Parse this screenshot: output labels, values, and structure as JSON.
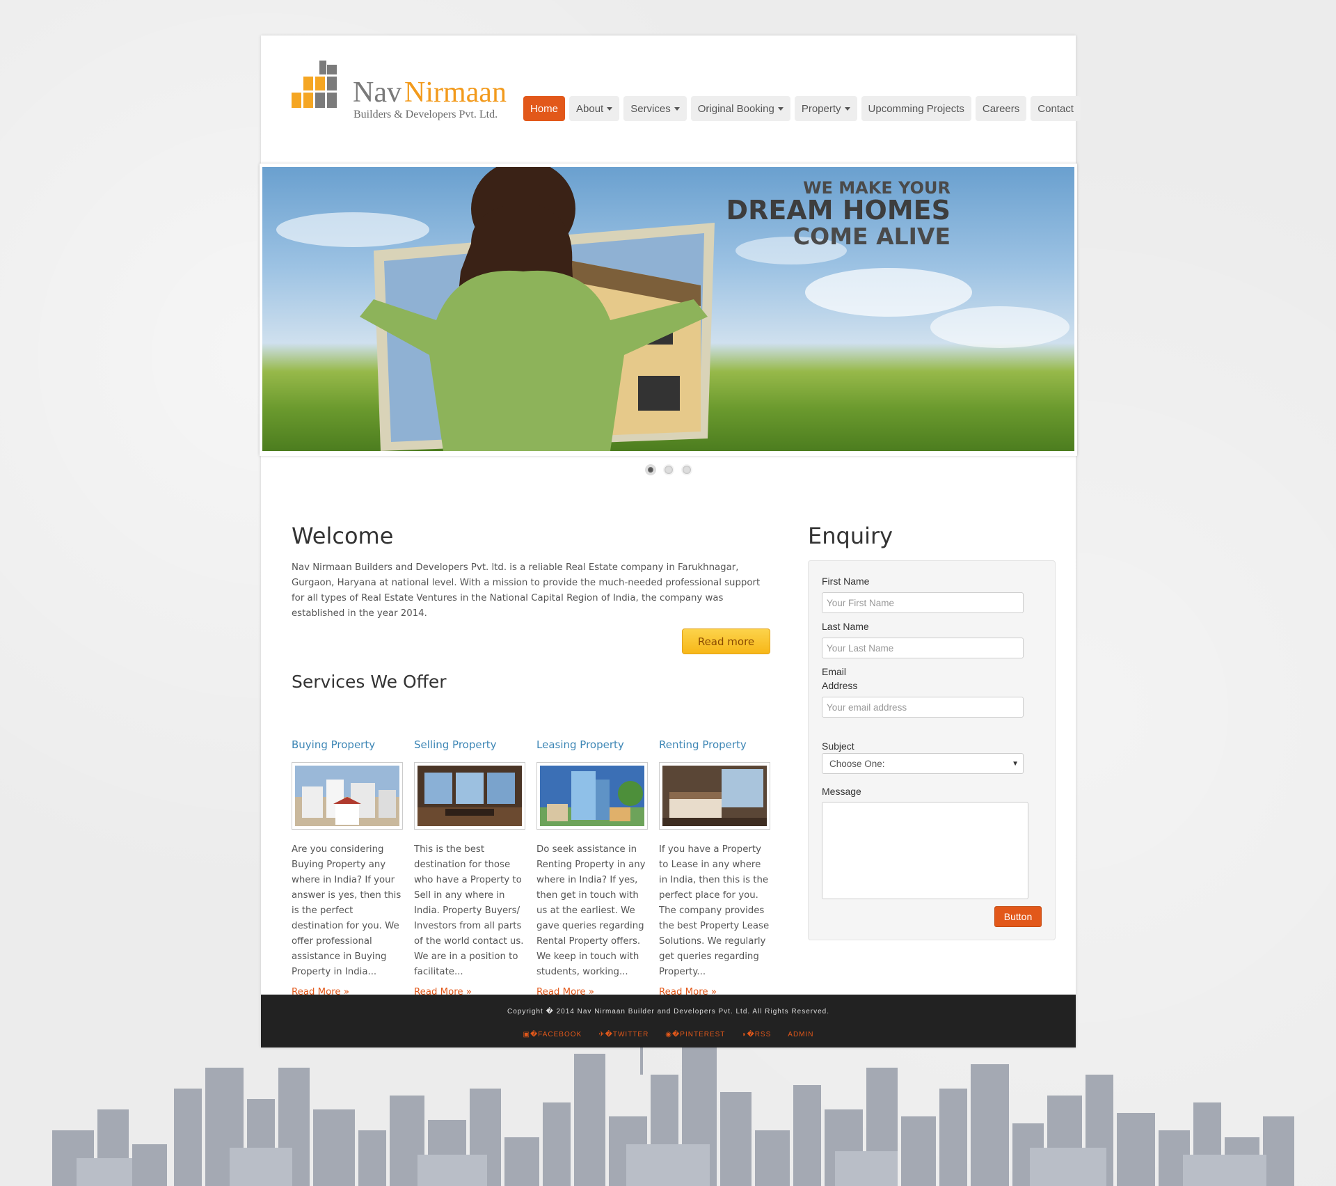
{
  "logo": {
    "name_part1": "Nav",
    "name_part2": "Nirmaan",
    "subtitle": "Builders & Developers Pvt. Ltd."
  },
  "nav": {
    "items": [
      {
        "label": "Home",
        "active": true,
        "dropdown": false
      },
      {
        "label": "About",
        "dropdown": true
      },
      {
        "label": "Services",
        "dropdown": true
      },
      {
        "label": "Original Booking",
        "dropdown": true
      },
      {
        "label": "Property",
        "dropdown": true
      },
      {
        "label": "Upcomming Projects",
        "dropdown": false
      },
      {
        "label": "Careers",
        "dropdown": false
      },
      {
        "label": "Contact",
        "dropdown": false
      }
    ]
  },
  "hero": {
    "line1": "WE MAKE YOUR",
    "line2": "DREAM HOMES",
    "line3": "COME ALIVE",
    "slides": 3,
    "active_slide": 1
  },
  "welcome": {
    "title": "Welcome",
    "text": "Nav Nirmaan Builders and Developers Pvt. ltd. is a reliable Real Estate company in Farukhnagar, Gurgaon, Haryana at national level. With a mission to provide the much-needed professional support for all types of Real Estate Ventures in the National Capital Region of India, the company was established in the year 2014.",
    "read_more": "Read more"
  },
  "services": {
    "title": "Services We Offer",
    "items": [
      {
        "title": "Buying Property",
        "text": "Are you considering Buying Property any where in India? If your answer is yes, then this is the perfect destination for you. We offer professional assistance in Buying Property in India...",
        "more": "Read More »"
      },
      {
        "title": "Selling Property",
        "text": "This is the best destination for those who have a Property to Sell in any where in India. Property Buyers/ Investors from all parts of the world contact us. We are in a position to facilitate...",
        "more": "Read More »"
      },
      {
        "title": "Leasing Property",
        "text": "Do seek assistance in Renting Property in any where in India? If yes, then get in touch with us at the earliest. We gave queries regarding Rental Property offers. We keep in touch with students, working...",
        "more": "Read More »"
      },
      {
        "title": "Renting Property",
        "text": "If you have a Property to Lease in any where in India, then this is the perfect place for you. The company provides the best Property Lease Solutions. We regularly get queries regarding Property...",
        "more": "Read More »"
      }
    ]
  },
  "enquiry": {
    "title": "Enquiry",
    "first_name_label": "First Name",
    "first_name_placeholder": "Your First Name",
    "last_name_label": "Last Name",
    "last_name_placeholder": "Your Last Name",
    "email_label_1": "Email",
    "email_label_2": "Address",
    "email_placeholder": "Your email address",
    "subject_label": "Subject",
    "subject_value": "Choose One:",
    "message_label": "Message",
    "button": "Button"
  },
  "footer": {
    "copyright": "Copyright � 2014 Nav Nirmaan Builder and Developers Pvt. Ltd. All Rights Reserved.",
    "links": [
      "�FACEBOOK",
      "�TWITTER",
      "�PINTEREST",
      "�RSS",
      "ADMIN"
    ]
  },
  "colors": {
    "accent": "#e2581a",
    "logo_orange": "#f29a1c",
    "link_blue": "#3d86b5",
    "footer_bg": "#222222"
  }
}
